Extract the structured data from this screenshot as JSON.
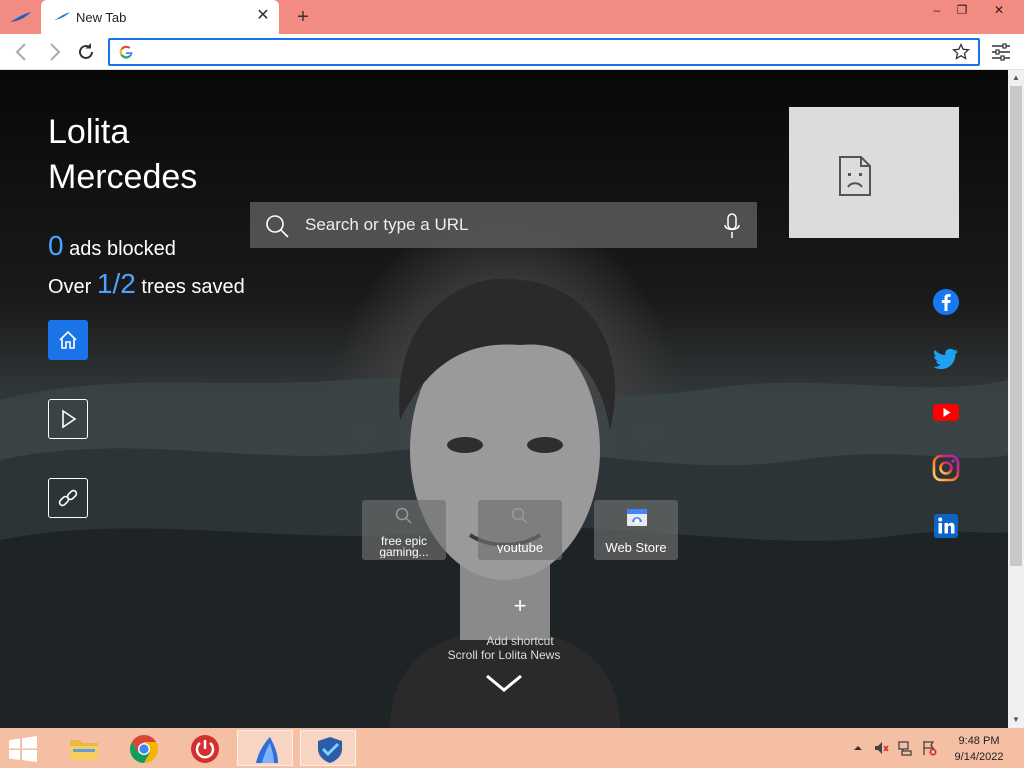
{
  "browser": {
    "tab_title": "New Tab",
    "new_tab_symbol": "+",
    "close_symbol": "✕",
    "window_controls": [
      "–",
      "❐",
      "✕"
    ],
    "omnibox_value": "",
    "icons": [
      "app-logo-icon",
      "back-icon",
      "forward-icon",
      "reload-icon",
      "google-g-icon",
      "star-icon",
      "settings-sliders-icon"
    ]
  },
  "profile": {
    "name": "Lolita Mercedes"
  },
  "stats": {
    "ads_count": "0",
    "ads_label": "ads blocked",
    "trees_prefix": "Over",
    "trees_count": "1/2",
    "trees_label": "trees saved"
  },
  "search": {
    "placeholder": "Search or type a URL"
  },
  "sidebar_icons": [
    "home-icon",
    "play-icon",
    "link-icon"
  ],
  "social_icons": [
    "facebook-icon",
    "twitter-icon",
    "youtube-icon",
    "instagram-icon",
    "linkedin-icon"
  ],
  "shortcuts": [
    {
      "label": "free epic gaming...",
      "icon": "search-icon"
    },
    {
      "label": "youtube",
      "icon": "search-icon"
    },
    {
      "label": "Web Store",
      "icon": "web-store-icon"
    }
  ],
  "add_shortcut": {
    "symbol": "+",
    "label": "Add shortcut"
  },
  "news": {
    "label": "Scroll for Lolita News"
  },
  "colors": {
    "titlebar": "#f28b82",
    "accent_blue": "#1a73e8",
    "stat_number": "#4aa3ff",
    "taskbar": "#f4bfa3"
  },
  "taskbar": {
    "apps": [
      "file-explorer-icon",
      "chrome-icon",
      "power-app-icon",
      "lolita-browser-icon",
      "shield-vpn-icon"
    ],
    "tray": [
      "tray-up-icon",
      "volume-muted-icon",
      "network-icon",
      "flag-alert-icon"
    ],
    "time": "9:48 PM",
    "date": "9/14/2022"
  }
}
